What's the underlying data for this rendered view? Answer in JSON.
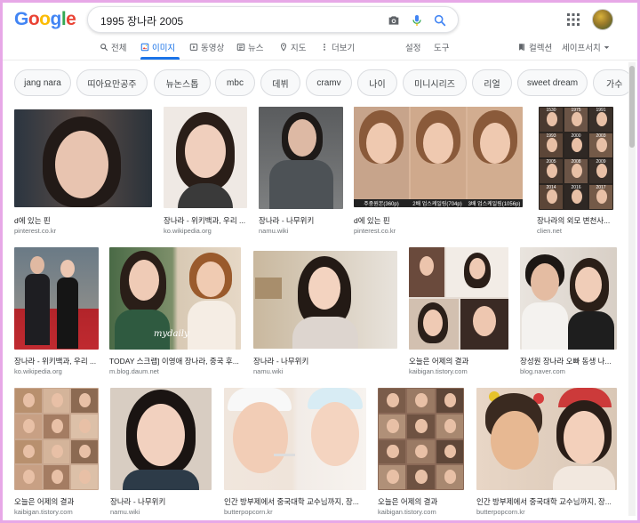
{
  "header": {
    "logo_letters": [
      {
        "char": "G",
        "color": "#4285f4"
      },
      {
        "char": "o",
        "color": "#ea4335"
      },
      {
        "char": "o",
        "color": "#fbbc05"
      },
      {
        "char": "g",
        "color": "#4285f4"
      },
      {
        "char": "l",
        "color": "#34a853"
      },
      {
        "char": "e",
        "color": "#ea4335"
      }
    ],
    "search_value": "1995 장나라 2005",
    "icons": [
      "camera-icon",
      "microphone-icon",
      "search-icon",
      "apps-icon",
      "avatar"
    ]
  },
  "tabs": [
    {
      "label": "전체",
      "icon": "search-icon",
      "active": false
    },
    {
      "label": "이미지",
      "icon": "image-icon",
      "active": true
    },
    {
      "label": "동영상",
      "icon": "video-icon",
      "active": false
    },
    {
      "label": "뉴스",
      "icon": "news-icon",
      "active": false
    },
    {
      "label": "지도",
      "icon": "map-pin-icon",
      "active": false
    },
    {
      "label": "더보기",
      "icon": "more-icon",
      "active": false
    },
    {
      "label": "설정",
      "active": false
    },
    {
      "label": "도구",
      "active": false
    },
    {
      "label": "컬렉션",
      "icon": "bookmark-icon",
      "active": false
    },
    {
      "label": "세이프서치",
      "icon": "chevron-down-icon",
      "active": false
    }
  ],
  "chips": [
    "jang nara",
    "띠아요만공주",
    "뉴논스톱",
    "mbc",
    "데뷔",
    "cramv",
    "나이",
    "미니시리즈",
    "리얼",
    "sweet dream",
    "가수"
  ],
  "accent_color": "#1a73e8",
  "results": [
    {
      "caption": "d에 있는 핀",
      "source": "pinterest.co.kr"
    },
    {
      "caption": "장나라 - 위키백과, 우리 ...",
      "source": "ko.wikipedia.org"
    },
    {
      "caption": "장나라 - 나무위키",
      "source": "namu.wiki"
    },
    {
      "caption": "d에 있는 핀",
      "source": "pinterest.co.kr"
    },
    {
      "caption": "장나라의 외모 변천사...",
      "source": "clien.net"
    },
    {
      "caption": "장나라 - 위키백과, 우리 ...",
      "source": "ko.wikipedia.org"
    },
    {
      "caption": "TODAY 스크랩] 이영애 장나라, 중국 후...",
      "source": "m.blog.daum.net"
    },
    {
      "caption": "장나라 - 나무위키",
      "source": "namu.wiki"
    },
    {
      "caption": "오늘은 어제의 결과",
      "source": "kaibigan.tistory.com"
    },
    {
      "caption": "장성원 장나라 오빠 동생 나...",
      "source": "blog.naver.com"
    },
    {
      "caption": "오늘은 어제의 결과",
      "source": "kaibigan.tistory.com"
    },
    {
      "caption": "장나라 - 나무위키",
      "source": "namu.wiki"
    },
    {
      "caption": "인간 방부제에서 중국대학 교수님까지, 장...",
      "source": "butterpopcorn.kr"
    },
    {
      "caption": "오늘은 어제의 결과",
      "source": "kaibigan.tistory.com"
    },
    {
      "caption": "인간 방부제에서 중국대학 교수님까지, 장...",
      "source": "butterpopcorn.kr"
    }
  ],
  "image_overlays": {
    "r4_labels": [
      "주중원본(360p)",
      "2배 업스케일링(704p)",
      "3배 업스케일링(1056p)"
    ],
    "r5_years": [
      "1530",
      "1975",
      "1991",
      "1993",
      "2000",
      "2003",
      "2005",
      "2008",
      "2009",
      "2014",
      "2016",
      "2017"
    ],
    "r7_watermark": "mydaily"
  }
}
